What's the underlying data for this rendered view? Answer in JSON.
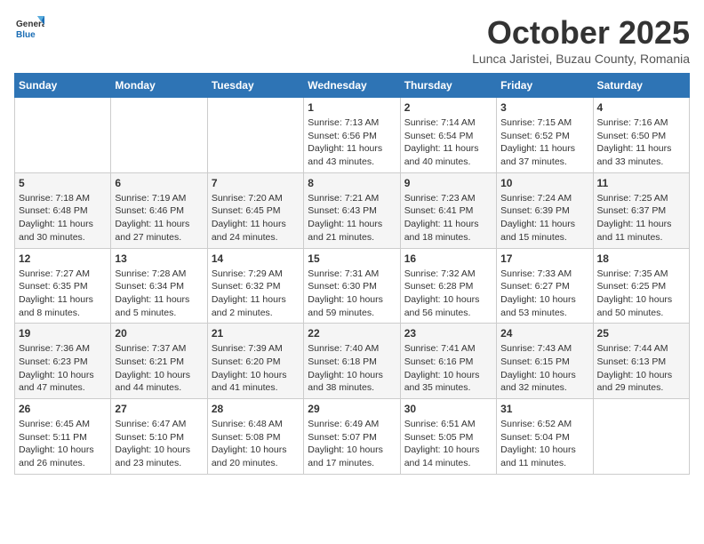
{
  "header": {
    "logo_line1": "General",
    "logo_line2": "Blue",
    "title": "October 2025",
    "subtitle": "Lunca Jaristei, Buzau County, Romania"
  },
  "days_of_week": [
    "Sunday",
    "Monday",
    "Tuesday",
    "Wednesday",
    "Thursday",
    "Friday",
    "Saturday"
  ],
  "weeks": [
    [
      {
        "day": "",
        "content": ""
      },
      {
        "day": "",
        "content": ""
      },
      {
        "day": "",
        "content": ""
      },
      {
        "day": "1",
        "content": "Sunrise: 7:13 AM\nSunset: 6:56 PM\nDaylight: 11 hours and 43 minutes."
      },
      {
        "day": "2",
        "content": "Sunrise: 7:14 AM\nSunset: 6:54 PM\nDaylight: 11 hours and 40 minutes."
      },
      {
        "day": "3",
        "content": "Sunrise: 7:15 AM\nSunset: 6:52 PM\nDaylight: 11 hours and 37 minutes."
      },
      {
        "day": "4",
        "content": "Sunrise: 7:16 AM\nSunset: 6:50 PM\nDaylight: 11 hours and 33 minutes."
      }
    ],
    [
      {
        "day": "5",
        "content": "Sunrise: 7:18 AM\nSunset: 6:48 PM\nDaylight: 11 hours and 30 minutes."
      },
      {
        "day": "6",
        "content": "Sunrise: 7:19 AM\nSunset: 6:46 PM\nDaylight: 11 hours and 27 minutes."
      },
      {
        "day": "7",
        "content": "Sunrise: 7:20 AM\nSunset: 6:45 PM\nDaylight: 11 hours and 24 minutes."
      },
      {
        "day": "8",
        "content": "Sunrise: 7:21 AM\nSunset: 6:43 PM\nDaylight: 11 hours and 21 minutes."
      },
      {
        "day": "9",
        "content": "Sunrise: 7:23 AM\nSunset: 6:41 PM\nDaylight: 11 hours and 18 minutes."
      },
      {
        "day": "10",
        "content": "Sunrise: 7:24 AM\nSunset: 6:39 PM\nDaylight: 11 hours and 15 minutes."
      },
      {
        "day": "11",
        "content": "Sunrise: 7:25 AM\nSunset: 6:37 PM\nDaylight: 11 hours and 11 minutes."
      }
    ],
    [
      {
        "day": "12",
        "content": "Sunrise: 7:27 AM\nSunset: 6:35 PM\nDaylight: 11 hours and 8 minutes."
      },
      {
        "day": "13",
        "content": "Sunrise: 7:28 AM\nSunset: 6:34 PM\nDaylight: 11 hours and 5 minutes."
      },
      {
        "day": "14",
        "content": "Sunrise: 7:29 AM\nSunset: 6:32 PM\nDaylight: 11 hours and 2 minutes."
      },
      {
        "day": "15",
        "content": "Sunrise: 7:31 AM\nSunset: 6:30 PM\nDaylight: 10 hours and 59 minutes."
      },
      {
        "day": "16",
        "content": "Sunrise: 7:32 AM\nSunset: 6:28 PM\nDaylight: 10 hours and 56 minutes."
      },
      {
        "day": "17",
        "content": "Sunrise: 7:33 AM\nSunset: 6:27 PM\nDaylight: 10 hours and 53 minutes."
      },
      {
        "day": "18",
        "content": "Sunrise: 7:35 AM\nSunset: 6:25 PM\nDaylight: 10 hours and 50 minutes."
      }
    ],
    [
      {
        "day": "19",
        "content": "Sunrise: 7:36 AM\nSunset: 6:23 PM\nDaylight: 10 hours and 47 minutes."
      },
      {
        "day": "20",
        "content": "Sunrise: 7:37 AM\nSunset: 6:21 PM\nDaylight: 10 hours and 44 minutes."
      },
      {
        "day": "21",
        "content": "Sunrise: 7:39 AM\nSunset: 6:20 PM\nDaylight: 10 hours and 41 minutes."
      },
      {
        "day": "22",
        "content": "Sunrise: 7:40 AM\nSunset: 6:18 PM\nDaylight: 10 hours and 38 minutes."
      },
      {
        "day": "23",
        "content": "Sunrise: 7:41 AM\nSunset: 6:16 PM\nDaylight: 10 hours and 35 minutes."
      },
      {
        "day": "24",
        "content": "Sunrise: 7:43 AM\nSunset: 6:15 PM\nDaylight: 10 hours and 32 minutes."
      },
      {
        "day": "25",
        "content": "Sunrise: 7:44 AM\nSunset: 6:13 PM\nDaylight: 10 hours and 29 minutes."
      }
    ],
    [
      {
        "day": "26",
        "content": "Sunrise: 6:45 AM\nSunset: 5:11 PM\nDaylight: 10 hours and 26 minutes."
      },
      {
        "day": "27",
        "content": "Sunrise: 6:47 AM\nSunset: 5:10 PM\nDaylight: 10 hours and 23 minutes."
      },
      {
        "day": "28",
        "content": "Sunrise: 6:48 AM\nSunset: 5:08 PM\nDaylight: 10 hours and 20 minutes."
      },
      {
        "day": "29",
        "content": "Sunrise: 6:49 AM\nSunset: 5:07 PM\nDaylight: 10 hours and 17 minutes."
      },
      {
        "day": "30",
        "content": "Sunrise: 6:51 AM\nSunset: 5:05 PM\nDaylight: 10 hours and 14 minutes."
      },
      {
        "day": "31",
        "content": "Sunrise: 6:52 AM\nSunset: 5:04 PM\nDaylight: 10 hours and 11 minutes."
      },
      {
        "day": "",
        "content": ""
      }
    ]
  ]
}
